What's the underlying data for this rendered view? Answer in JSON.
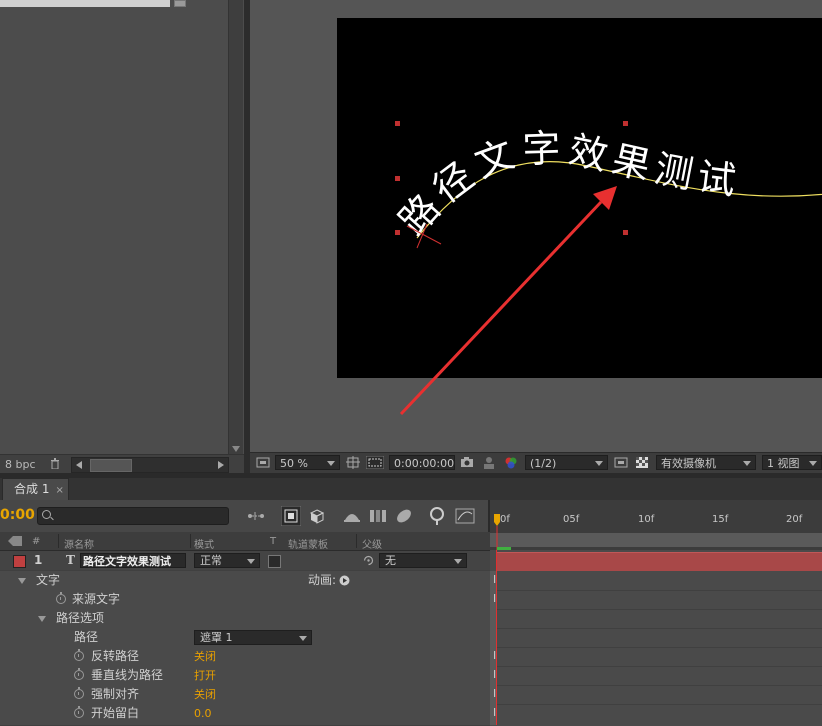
{
  "project_panel": {
    "bpc": "8 bpc"
  },
  "viewer": {
    "path_text": "路径文字效果测试",
    "zoom": "50 %",
    "timecode": "0:00:00:00",
    "resolution": "(1/2)",
    "camera": "有效摄像机",
    "views": "1 视图"
  },
  "timeline": {
    "tab_label": "合成 1",
    "tab_close": "×",
    "current_time": "0:00",
    "ruler_ticks": [
      "0f",
      "05f",
      "10f",
      "15f",
      "20f"
    ],
    "columns": {
      "num": "#",
      "source_name": "源名称",
      "mode": "模式",
      "t": "T",
      "trkmat": "轨道蒙板",
      "parent": "父级"
    },
    "layer": {
      "number": "1",
      "type_icon": "T",
      "name": "路径文字效果测试",
      "mode": "正常",
      "parent": "无",
      "label_color": "#c04040"
    },
    "properties": [
      {
        "label": "文字",
        "extra": "动画:"
      },
      {
        "label": "来源文字"
      },
      {
        "label": "路径选项"
      },
      {
        "label": "路径",
        "value": "遮罩 1"
      },
      {
        "label": "反转路径",
        "value": "关闭"
      },
      {
        "label": "垂直线为路径",
        "value": "打开"
      },
      {
        "label": "强制对齐",
        "value": "关闭"
      },
      {
        "label": "开始留白",
        "value": "0.0"
      }
    ]
  },
  "colors": {
    "accent_orange": "#e8a000",
    "track_red": "#a84848",
    "arrow_red": "#e83030",
    "path_yellow": "#f0e060"
  }
}
